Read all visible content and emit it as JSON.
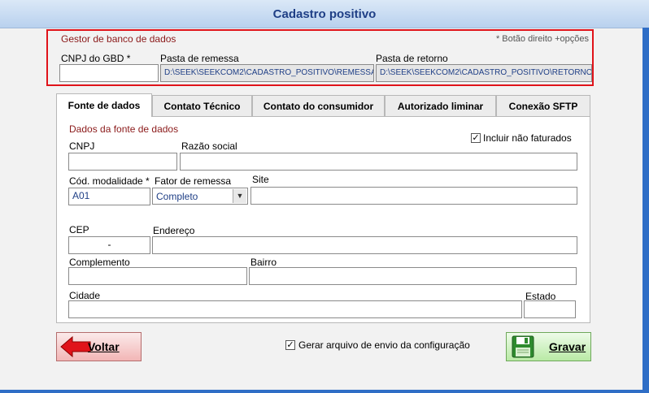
{
  "window": {
    "title": "Cadastro positivo"
  },
  "gbd": {
    "title": "Gestor de banco de dados",
    "hint": "* Botão direito +opções",
    "cnpj_label": "CNPJ do GBD *",
    "cnpj_value": "",
    "remessa_label": "Pasta de remessa",
    "remessa_path": "D:\\SEEK\\SEEKCOM2\\CADASTRO_POSITIVO\\REMESSA\\",
    "retorno_label": "Pasta de retorno",
    "retorno_path": "D:\\SEEK\\SEEKCOM2\\CADASTRO_POSITIVO\\RETORNO\\"
  },
  "tabs": [
    {
      "label": "Fonte de dados",
      "active": true
    },
    {
      "label": "Contato Técnico"
    },
    {
      "label": "Contato do consumidor"
    },
    {
      "label": "Autorizado liminar"
    },
    {
      "label": "Conexão SFTP"
    }
  ],
  "fonte": {
    "section_title": "Dados da fonte de dados",
    "incluir_label": "Incluir não faturados",
    "incluir_checked": "✓",
    "cnpj_label": "CNPJ",
    "razao_label": "Razão social",
    "modalidade_label": "Cód. modalidade *",
    "modalidade_value": "A01",
    "fator_label": "Fator de remessa",
    "fator_value": "Completo",
    "site_label": "Site",
    "cep_label": "CEP",
    "cep_value": "-",
    "endereco_label": "Endereço",
    "complemento_label": "Complemento",
    "bairro_label": "Bairro",
    "cidade_label": "Cidade",
    "estado_label": "Estado"
  },
  "footer": {
    "voltar_label": "Voltar",
    "gerar_label": "Gerar arquivo de envio da configuração",
    "gerar_checked": "✓",
    "gravar_label": "Gravar"
  }
}
